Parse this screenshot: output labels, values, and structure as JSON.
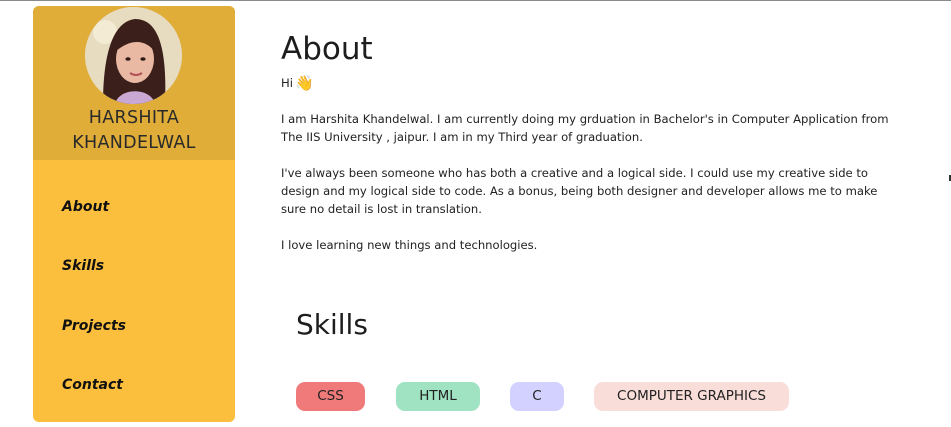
{
  "profile": {
    "name_line1": "HARSHITA",
    "name_line2": "KHANDELWAL"
  },
  "nav": {
    "items": [
      "About",
      "Skills",
      "Projects",
      "Contact"
    ]
  },
  "about": {
    "title": "About",
    "greeting": "Hi",
    "wave_emoji": "👋",
    "paragraphs": [
      "I am Harshita Khandelwal. I am currently doing my grduation in Bachelor's in Computer Application from The IIS University , jaipur. I am in my Third year of graduation.",
      "I've always been someone who has both a creative and a logical side. I could use my creative side to design and my logical side to code. As a bonus, being both designer and developer allows me to make sure no detail is lost in translation.",
      "I love learning new things and technologies."
    ]
  },
  "skills": {
    "title": "Skills",
    "items": [
      {
        "label": "CSS",
        "color": "#f07a7a"
      },
      {
        "label": "HTML",
        "color": "#9fe3c2"
      },
      {
        "label": "C",
        "color": "#d3d1ff"
      },
      {
        "label": "COMPUTER GRAPHICS",
        "color": "#f9ddd9"
      }
    ]
  },
  "colors": {
    "sidebar_bg": "#fbbf3d",
    "profile_bg": "#e0ad38"
  }
}
